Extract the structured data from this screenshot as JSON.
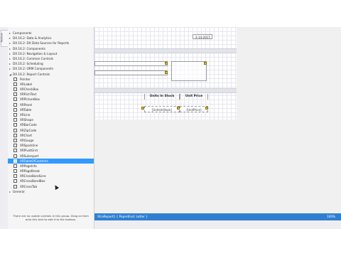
{
  "side_tab": {
    "label": "Toolbox"
  },
  "toolbox": {
    "rows": [
      {
        "kind": "cat",
        "arrow": "▸",
        "label": "Components"
      },
      {
        "kind": "cat",
        "arrow": "▸",
        "label": "DX.16.2: Data & Analytics"
      },
      {
        "kind": "cat",
        "arrow": "▸",
        "label": "DX.16.2: DX Data Sources for Reports"
      },
      {
        "kind": "cat",
        "arrow": "▸",
        "label": "DX.16.2: Components"
      },
      {
        "kind": "cat",
        "arrow": "▸",
        "label": "DX.16.2: Navigation & Layout"
      },
      {
        "kind": "cat",
        "arrow": "▸",
        "label": "DX.16.2: Common Controls"
      },
      {
        "kind": "cat",
        "arrow": "▸",
        "label": "DX.16.2: Scheduling"
      },
      {
        "kind": "cat",
        "arrow": "▸",
        "label": "DX.16.2: ORM Components"
      },
      {
        "kind": "cat",
        "arrow": "◢",
        "label": "DX.16.2: Report Controls"
      },
      {
        "kind": "item",
        "label": "Pointer"
      },
      {
        "kind": "item",
        "label": "XRLabel"
      },
      {
        "kind": "item",
        "label": "XRCheckBox"
      },
      {
        "kind": "item",
        "label": "XRRichText"
      },
      {
        "kind": "item",
        "label": "XRPictureBox"
      },
      {
        "kind": "item",
        "label": "XRPanel"
      },
      {
        "kind": "item",
        "label": "XRTable"
      },
      {
        "kind": "item",
        "label": "XRLine"
      },
      {
        "kind": "item",
        "label": "XRShape"
      },
      {
        "kind": "item",
        "label": "XRBarCode"
      },
      {
        "kind": "item",
        "label": "XRZipCode"
      },
      {
        "kind": "item",
        "label": "XRChart"
      },
      {
        "kind": "item",
        "label": "XRGauge"
      },
      {
        "kind": "item",
        "label": "XRSparkline"
      },
      {
        "kind": "item",
        "label": "XRPivotGrid"
      },
      {
        "kind": "item",
        "label": "XRSubreport"
      },
      {
        "kind": "item",
        "label": "XRTableOfContents",
        "selected": true
      },
      {
        "kind": "item",
        "label": "XRPageInfo"
      },
      {
        "kind": "item",
        "label": "XRPageBreak"
      },
      {
        "kind": "item",
        "label": "XRCrossBandLine"
      },
      {
        "kind": "item",
        "label": "XRCrossBandBox"
      },
      {
        "kind": "item",
        "label": "XRCrossTab"
      },
      {
        "kind": "cat",
        "arrow": "▸",
        "label": "General"
      }
    ],
    "help_line1": "There are no usable controls in this group. Drag an item",
    "help_line2": "onto this text to add it to the toolbox."
  },
  "designer": {
    "date_field": "2-14-2017",
    "col_units": "Units In Stock",
    "col_price": "Unit Price",
    "cell_units": "[UnitsInStock]",
    "cell_price": "[UnitPrice]"
  },
  "status": {
    "left": "XtraReport1 { PaperKind: Letter }",
    "right": "100%"
  },
  "colors": {
    "accent": "#3399ff",
    "statusbar": "#2f7fd1"
  }
}
